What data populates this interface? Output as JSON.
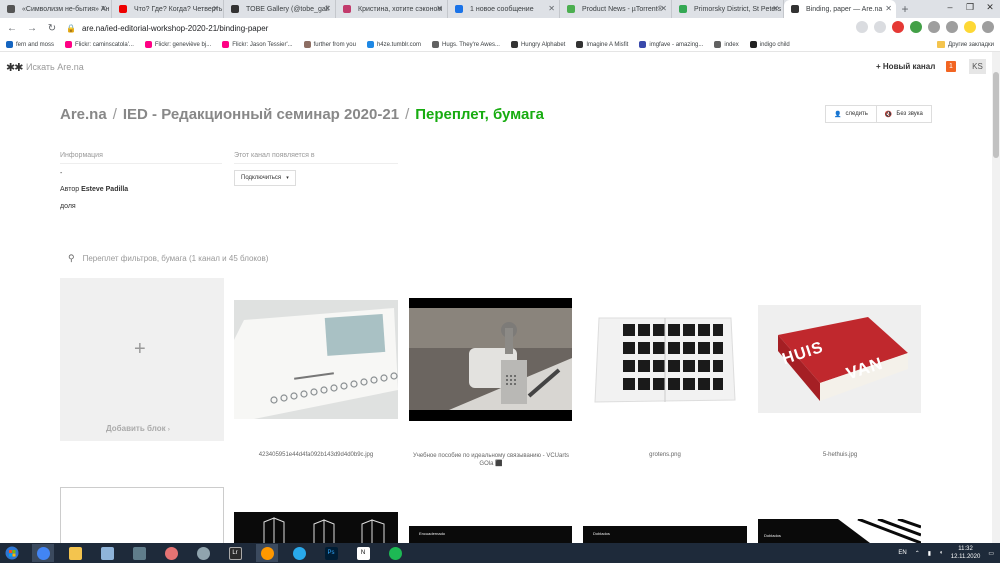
{
  "browser": {
    "tabs": [
      {
        "title": "«Символизм не-бытия» Ан",
        "color": "#555"
      },
      {
        "title": "Что? Где? Когда? Четверть",
        "color": "#e00"
      },
      {
        "title": "TOBE Gallery (@tobe_gall",
        "color": "#333"
      },
      {
        "title": "Кристина, хотите сэконом",
        "color": "#c23b6c"
      },
      {
        "title": "1 новое сообщение",
        "color": "#1a73e8"
      },
      {
        "title": "Product News - µTorrent®",
        "color": "#4caf50"
      },
      {
        "title": "Primorsky District, St Peters",
        "color": "#34a853"
      },
      {
        "title": "Binding, paper — Are.na",
        "color": "#333"
      }
    ],
    "url": "are.na/ied-editorial-workshop-2020-21/binding-paper",
    "bookmarks": [
      "fern and moss",
      "Flickr: caminscatola'...",
      "Flickr: geneviève bj...",
      "Flickr: Jason Tessier'...",
      "further from you",
      "h4ze.tumblr.com",
      "Hugs. They're Awes...",
      "Hungry Alphabet",
      "Imagine A Misfit",
      "imgfave - amazing...",
      "index",
      "indigo child"
    ],
    "other_bookmarks": "Другие закладки"
  },
  "nav": {
    "logo": "✱✱",
    "search_placeholder": "Искать Are.na",
    "new_channel": "Новый канал",
    "notifications": "1",
    "avatar": "KS"
  },
  "breadcrumb": {
    "root": "Are.na",
    "parent": "IED - Редакционный семинар 2020-21",
    "current": "Переплет, бумага"
  },
  "actions": {
    "follow": "следить",
    "mute": "Без звука"
  },
  "info": {
    "heading": "Информация",
    "dash": "-",
    "author_prefix": "Автор",
    "author": "Esteve Padilla",
    "share": "доля",
    "appears_heading": "Этот канал появляется в",
    "connect": "Подключиться"
  },
  "filter": {
    "placeholder": "Переплет фильтров, бумага (1 канал и 45 блоков)"
  },
  "add_block": {
    "plus": "+",
    "label": "Добавить блок"
  },
  "blocks": [
    {
      "caption": "423405951e44d4fa092b143d9d4d0b9c.jpg"
    },
    {
      "caption": "Учебное пособие по идеальному связыванию - VCUarts GOla ⬛"
    },
    {
      "caption": "grotens.png"
    },
    {
      "caption": "5-hethuis.jpg"
    }
  ],
  "block_labels": {
    "encuadernado": "Encuadernado",
    "doblados1": "Doblados",
    "doblados2": "Doblados",
    "huis": "HUIS",
    "van": "VAN"
  },
  "taskbar": {
    "lang": "EN",
    "time": "11:32",
    "date": "12.11.2020"
  }
}
